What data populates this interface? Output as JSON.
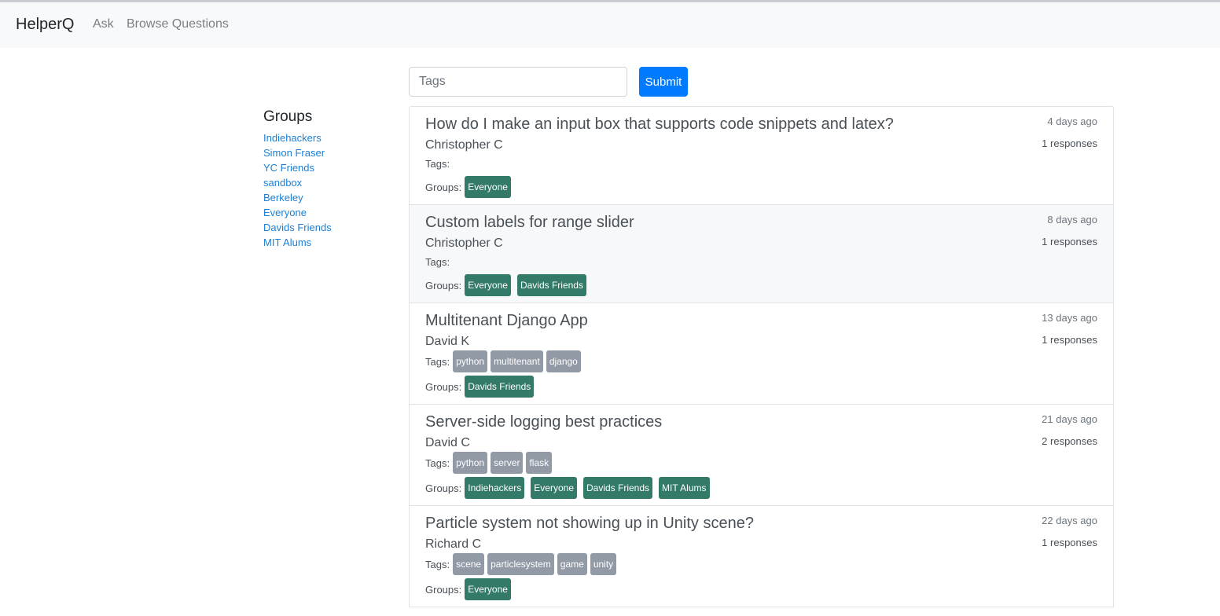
{
  "nav": {
    "brand": "HelperQ",
    "ask": "Ask",
    "browse": "Browse Questions"
  },
  "search": {
    "placeholder": "Tags",
    "submit_label": "Submit"
  },
  "sidebar": {
    "title": "Groups",
    "items": [
      "Indiehackers",
      "Simon Fraser",
      "YC Friends",
      "sandbox",
      "Berkeley",
      "Everyone",
      "Davids Friends",
      "MIT Alums"
    ]
  },
  "labels": {
    "tags": "Tags:",
    "groups": "Groups:"
  },
  "colors": {
    "primary": "#007bff",
    "group_badge": "#337a68",
    "tag_badge": "#929aa6",
    "link": "#1a7fd6"
  },
  "questions": [
    {
      "title": "How do I make an input box that supports code snippets and latex?",
      "author": "Christopher C",
      "time": "4 days ago",
      "responses": "1 responses",
      "tags": [],
      "groups": [
        "Everyone"
      ]
    },
    {
      "title": "Custom labels for range slider",
      "author": "Christopher C",
      "time": "8 days ago",
      "responses": "1 responses",
      "tags": [],
      "groups": [
        "Everyone",
        "Davids Friends"
      ]
    },
    {
      "title": "Multitenant Django App",
      "author": "David K",
      "time": "13 days ago",
      "responses": "1 responses",
      "tags": [
        "python",
        "multitenant",
        "django"
      ],
      "groups": [
        "Davids Friends"
      ]
    },
    {
      "title": "Server-side logging best practices",
      "author": "David C",
      "time": "21 days ago",
      "responses": "2 responses",
      "tags": [
        "python",
        "server",
        "flask"
      ],
      "groups": [
        "Indiehackers",
        "Everyone",
        "Davids Friends",
        "MIT Alums"
      ]
    },
    {
      "title": "Particle system not showing up in Unity scene?",
      "author": "Richard C",
      "time": "22 days ago",
      "responses": "1 responses",
      "tags": [
        "scene",
        "particlesystem",
        "game",
        "unity"
      ],
      "groups": [
        "Everyone"
      ]
    }
  ]
}
